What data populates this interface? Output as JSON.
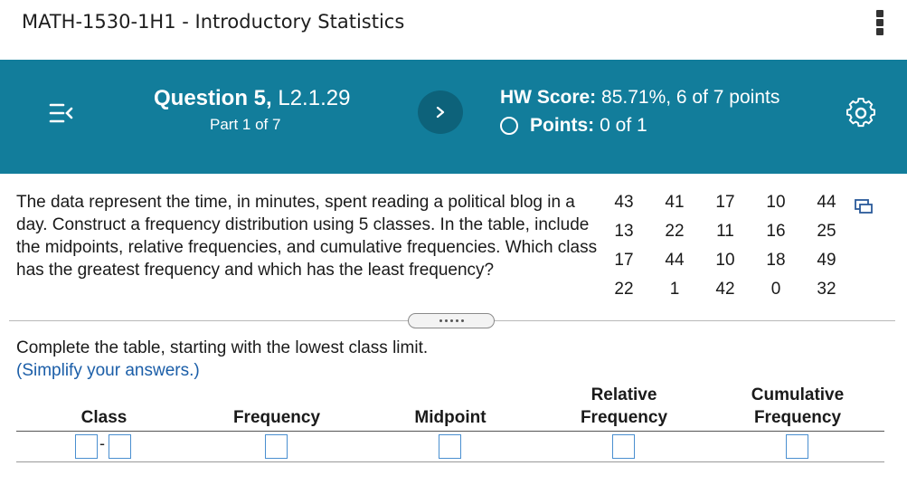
{
  "course": {
    "title": "MATH-1530-1H1 - Introductory Statistics"
  },
  "header": {
    "question_label": "Question 5,",
    "question_id": " L2.1.29",
    "part": "Part 1 of 7",
    "hw_score_label": "HW Score:",
    "hw_score_value": " 85.71%, 6 of 7 points",
    "points_label": "Points:",
    "points_value": "0 of 1"
  },
  "question": {
    "text": "The data represent the time, in minutes, spent reading a political blog in a day. Construct a frequency distribution using 5 classes. In the table, include the midpoints, relative frequencies, and cumulative frequencies. Which class has the greatest frequency and which has the least frequency?",
    "data": [
      [
        "43",
        "41",
        "17",
        "10",
        "44"
      ],
      [
        "13",
        "22",
        "11",
        "16",
        "25"
      ],
      [
        "17",
        "44",
        "10",
        "18",
        "49"
      ],
      [
        "22",
        "1",
        "42",
        "0",
        "32"
      ]
    ]
  },
  "instructions": {
    "main": "Complete the table, starting with the lowest class limit.",
    "simplify": "(Simplify your answers.)"
  },
  "table": {
    "headers": {
      "class": "Class",
      "frequency": "Frequency",
      "midpoint": "Midpoint",
      "relative_line1": "Relative",
      "relative_line2": "Frequency",
      "cumulative_line1": "Cumulative",
      "cumulative_line2": "Frequency"
    },
    "class_separator": "-"
  },
  "colors": {
    "header_bg": "#127d9b",
    "next_button": "#0d627a",
    "link_blue": "#1b5ea8",
    "input_border": "#4a8fd0"
  },
  "icons": {
    "menu": "menu-collapse-icon",
    "next": "chevron-right-icon",
    "settings": "gear-icon",
    "copy": "copy-data-icon",
    "more": "kebab-menu-icon"
  }
}
